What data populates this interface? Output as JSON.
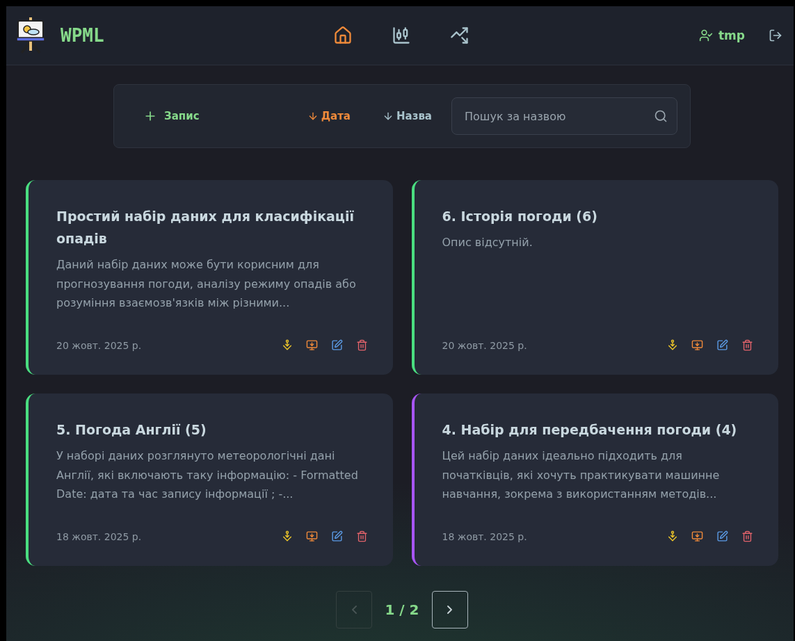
{
  "header": {
    "brand": "WPML",
    "nav": [
      {
        "kind": "home",
        "selected": true
      },
      {
        "kind": "candles",
        "selected": false
      },
      {
        "kind": "trend",
        "selected": false
      }
    ],
    "user": "tmp"
  },
  "toolbar": {
    "add": "Запис",
    "sorts": [
      {
        "label": "Дата",
        "selected": true
      },
      {
        "label": "Назва",
        "selected": false
      }
    ],
    "search": {
      "placeholder": "Пошук за назвою"
    }
  },
  "cards": [
    {
      "title": "Простий набір даних для класифікації опадів",
      "description": "Даний набір даних може бути корисним для прогнозування погоди, аналізу режиму опадів або розуміння взаємозв'язків між різними...",
      "date": "20 жовт. 2025 р.",
      "color": "#4ade80"
    },
    {
      "title": "6. Історія погоди (6)",
      "description": "Опис відсутній.",
      "date": "20 жовт. 2025 р.",
      "color": "#4ade80"
    },
    {
      "title": "5. Погода Англії (5)",
      "description": "У наборі даних розглянуто метеорологічні дані Англії, які включають таку інформацію: - Formatted Date: дата та час запису інформації ; -...",
      "date": "18 жовт. 2025 р.",
      "color": "#4ade80"
    },
    {
      "title": "4. Набір для передбачення погоди (4)",
      "description": "Цей набір даних ідеально підходить для початківців, які хочуть практикувати машинне навчання, зокрема з використанням методів...",
      "date": "18 жовт. 2025 р.",
      "color": "#a855f7"
    }
  ],
  "pagination": {
    "page": "1 / 2",
    "prev_disabled": true,
    "next_disabled": false
  }
}
